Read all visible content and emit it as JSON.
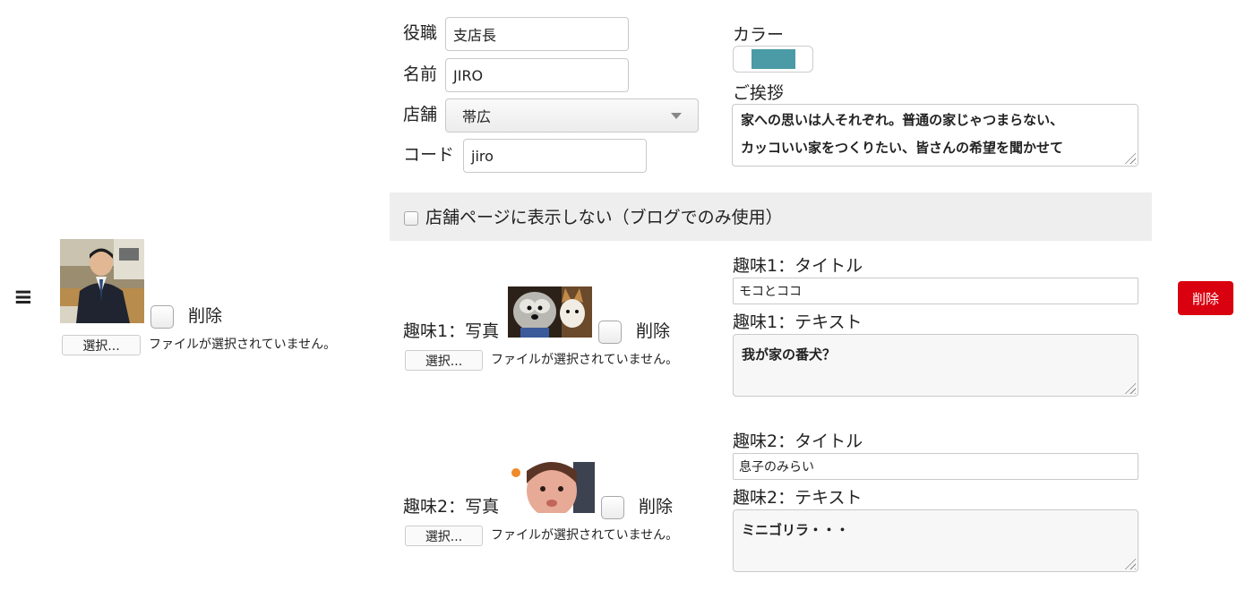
{
  "drag_handle": "≡",
  "profile": {
    "photo_alt": "profile photo",
    "delete_label": "削除",
    "file_button": "選択...",
    "file_status": "ファイルが選択されていません。"
  },
  "fields": {
    "position_label": "役職",
    "position_value": "支店長",
    "name_label": "名前",
    "name_value": "JIRO",
    "store_label": "店舗",
    "store_value": "帯広",
    "code_label": "コード",
    "code_value": "jiro",
    "color_label": "カラー",
    "color_value": "#4a9ba5",
    "greeting_label": "ご挨拶",
    "greeting_line1": "家への思いは人それぞれ。普通の家じゃつまらない、",
    "greeting_line2": "カッコいい家をつくりたい、皆さんの希望を聞かせて"
  },
  "hide_option": "店舗ページに表示しない（ブログでのみ使用）",
  "hobbies": [
    {
      "photo_label": "趣味1：写真",
      "delete_label": "削除",
      "file_button": "選択...",
      "file_status": "ファイルが選択されていません。",
      "title_label": "趣味1：タイトル",
      "title_value": "モコとココ",
      "text_label": "趣味1：テキスト",
      "text_value": "我が家の番犬？"
    },
    {
      "photo_label": "趣味2：写真",
      "delete_label": "削除",
      "file_button": "選択...",
      "file_status": "ファイルが選択されていません。",
      "title_label": "趣味2：タイトル",
      "title_value": "息子のみらい",
      "text_label": "趣味2：テキスト",
      "text_value": "ミニゴリラ・・・"
    }
  ],
  "row_delete": "削除",
  "colors": {
    "delete_red": "#d9000f",
    "panel_gray": "#eeeeee"
  }
}
